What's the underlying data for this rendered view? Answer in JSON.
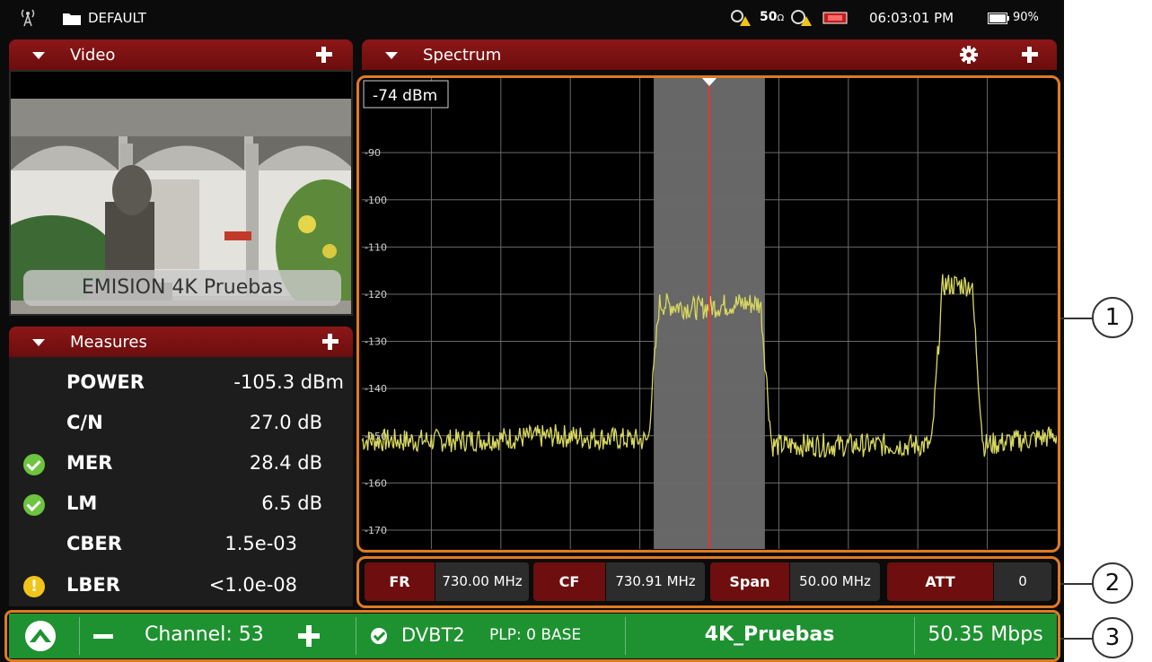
{
  "status": {
    "profile": "DEFAULT",
    "indicator_value": "50",
    "indicator_unit": "Ω",
    "time": "06:03:01 PM",
    "battery": "90%"
  },
  "video": {
    "title": "Video",
    "caption": "EMISION 4K Pruebas"
  },
  "measures": {
    "title": "Measures",
    "rows": [
      {
        "name": "POWER",
        "value": "-105.3 dBm",
        "status": "none"
      },
      {
        "name": "C/N",
        "value": "27.0 dB",
        "status": "none"
      },
      {
        "name": "MER",
        "value": "28.4 dB",
        "status": "ok"
      },
      {
        "name": "LM",
        "value": "6.5 dB",
        "status": "ok"
      },
      {
        "name": "CBER",
        "value": "1.5e-03",
        "status": "none"
      },
      {
        "name": "LBER",
        "value": "<1.0e-08",
        "status": "warning"
      }
    ]
  },
  "spectrum": {
    "title": "Spectrum",
    "ref_level": "-74 dBm"
  },
  "chart_data": {
    "type": "line",
    "y_ticks": [
      -90,
      -100,
      -110,
      -120,
      -130,
      -140,
      -150,
      -160,
      -170
    ],
    "ylim": [
      -174,
      -74
    ],
    "xlim": [
      705.91,
      755.91
    ],
    "grid": true,
    "center_frequency": 730.91,
    "channel_band": [
      726.91,
      734.91
    ],
    "series": [
      {
        "x": [
          705.91,
          713.0,
          720.0,
          726.5,
          727.3,
          730.0,
          733.0,
          734.6,
          735.4,
          740.0,
          745.0,
          746.9,
          747.7,
          749.8,
          750.6,
          755.91
        ],
        "values": [
          -151,
          -151,
          -150,
          -151,
          -122,
          -123,
          -122,
          -122,
          -152,
          -152,
          -152,
          -152,
          -118,
          -118,
          -152,
          -150
        ]
      }
    ],
    "marker_color": "#ff2a2a",
    "trace_color": "#d8d860",
    "band_color": "#8a8a8a"
  },
  "params": [
    {
      "label": "FR",
      "value": "730.00 MHz"
    },
    {
      "label": "CF",
      "value": "730.91 MHz"
    },
    {
      "label": "Span",
      "value": "50.00 MHz"
    },
    {
      "label": "ATT",
      "value": "0"
    }
  ],
  "bottom": {
    "channel": "Channel: 53",
    "standard": "DVBT2",
    "plp": "PLP: 0 BASE",
    "service": "4K_Pruebas",
    "bitrate": "50.35 Mbps"
  },
  "callouts": [
    "1",
    "2",
    "3"
  ],
  "colors": {
    "panel_header": "#7a1010",
    "accent_orange": "#e07a22",
    "bottom_bar": "#1e9230"
  }
}
